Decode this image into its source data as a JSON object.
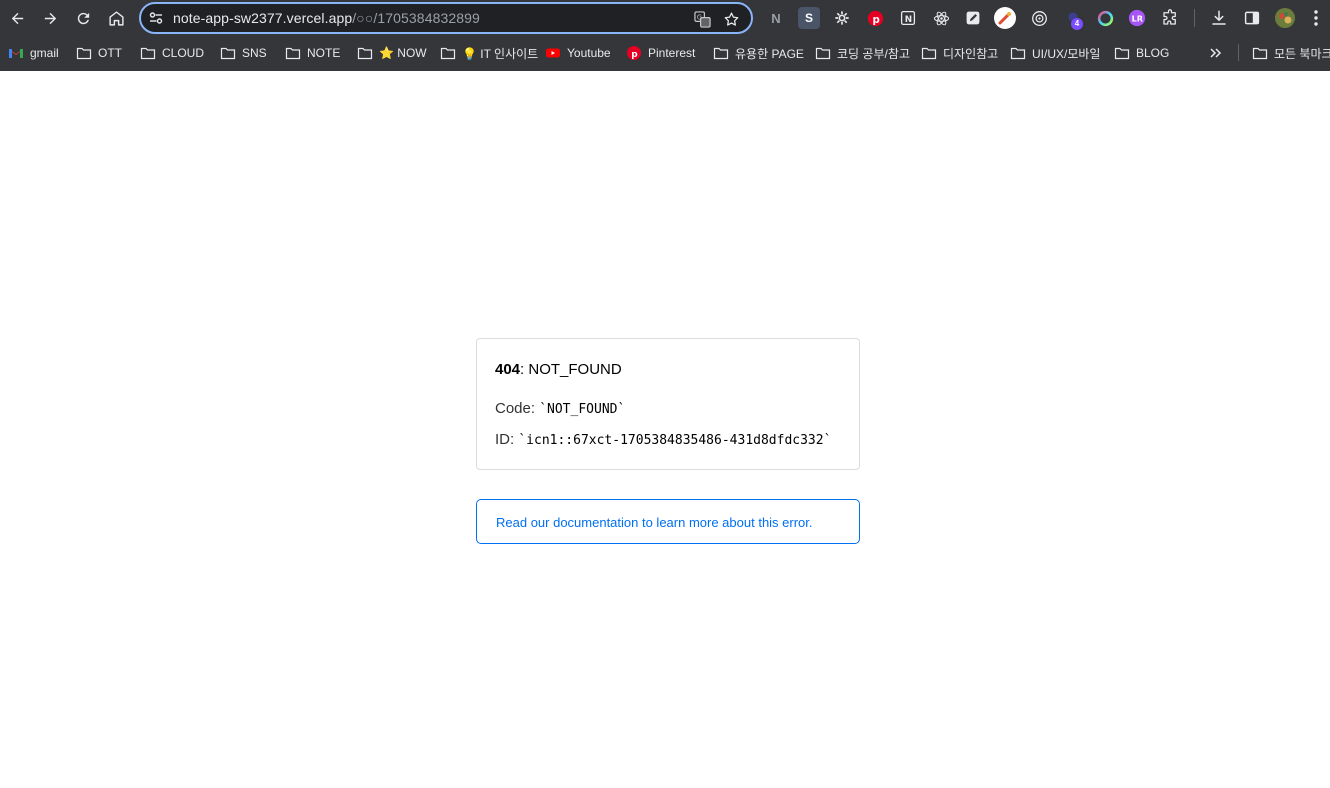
{
  "browser": {
    "url_host": "note-app-sw2377.vercel.app",
    "url_path": "/○○/1705384832899",
    "extension_badge": "4",
    "bookmarks": [
      {
        "label": "gmail",
        "icon": "gmail-icon"
      },
      {
        "label": "OTT",
        "icon": "folder-icon"
      },
      {
        "label": "CLOUD",
        "icon": "folder-icon"
      },
      {
        "label": "SNS",
        "icon": "folder-icon"
      },
      {
        "label": "NOTE",
        "icon": "folder-icon"
      },
      {
        "label": "⭐ NOW",
        "icon": "folder-icon"
      },
      {
        "label": "💡 IT 인사이트",
        "icon": "folder-icon"
      },
      {
        "label": "Youtube",
        "icon": "youtube-icon"
      },
      {
        "label": "Pinterest",
        "icon": "pinterest-icon"
      },
      {
        "label": "유용한 PAGE",
        "icon": "folder-icon"
      },
      {
        "label": "코딩 공부/참고",
        "icon": "folder-icon"
      },
      {
        "label": "디자인참고",
        "icon": "folder-icon"
      },
      {
        "label": "UI/UX/모바일",
        "icon": "folder-icon"
      },
      {
        "label": "BLOG",
        "icon": "folder-icon"
      }
    ],
    "all_bookmarks_label": "모든 북마크",
    "colors": {
      "chrome_bg": "#35363a",
      "omnibox_border": "#8ab4f8",
      "link_blue": "#0070f3"
    }
  },
  "error": {
    "status_code": "404",
    "status_text": ": NOT_FOUND",
    "code_label": "Code:",
    "code_value": "`NOT_FOUND`",
    "id_label": "ID:",
    "id_value": "`icn1::67xct-1705384835486-431d8dfdc332`"
  },
  "docs": {
    "link_text": "Read our documentation to learn more about this error."
  }
}
